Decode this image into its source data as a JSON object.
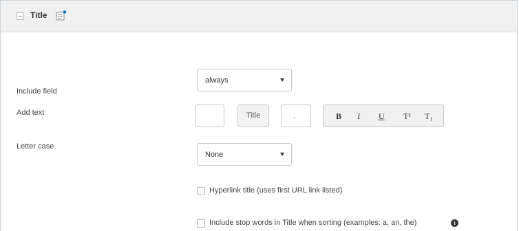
{
  "section": {
    "title": "Title"
  },
  "fields": {
    "include_field": {
      "label": "Include field",
      "value": "always"
    },
    "add_text": {
      "label": "Add text",
      "prefix_value": "",
      "title_button": "Title",
      "suffix_value": ".",
      "format_buttons": [
        "B",
        "I",
        "U",
        "T¹",
        "T₁"
      ]
    },
    "letter_case": {
      "label": "Letter case",
      "value": "None"
    }
  },
  "options": {
    "hyperlink": {
      "label": "Hyperlink title (uses first URL link listed)",
      "checked": false
    },
    "stop_words": {
      "label": "Include stop words in Title when sorting (examples: a, an, the)",
      "checked": false
    }
  },
  "icons": {
    "collapse": "collapse-icon",
    "note": "note-icon",
    "info": "info-icon"
  },
  "colors": {
    "header_bg": "#f1f1f1",
    "border": "#c6c6c6",
    "note_dot": "#1e73be"
  }
}
